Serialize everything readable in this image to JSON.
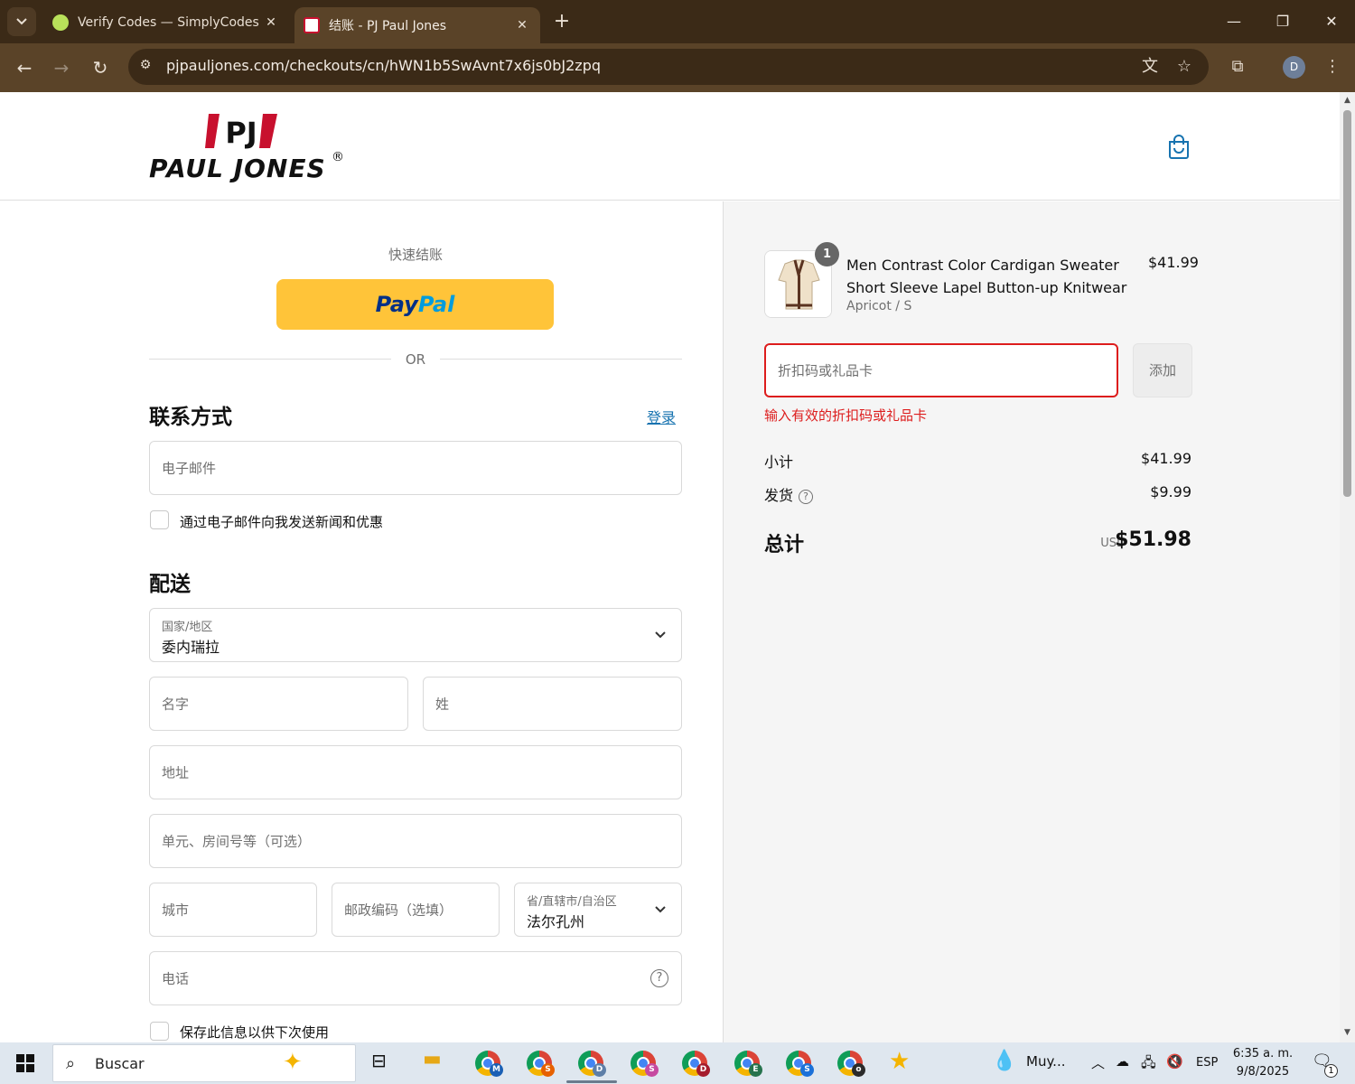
{
  "browser": {
    "tabs": [
      {
        "title": "Verify Codes — SimplyCodes",
        "active": false,
        "close_label": "✕"
      },
      {
        "title": "结账 - PJ Paul Jones",
        "active": true,
        "close_label": "✕"
      }
    ],
    "new_tab_label": "+",
    "url": "pjpauljones.com/checkouts/cn/hWN1b5SwAvnt7x6js0bJ2zpq",
    "profile_initial": "D",
    "accent_color": "#3b2a17"
  },
  "header": {
    "brand": "PAUL JONES",
    "brand_mark": "PJ",
    "registered": "®"
  },
  "express": {
    "title": "快速结账",
    "paypal_part1": "Pay",
    "paypal_part2": "Pal",
    "or_label": "OR"
  },
  "contact": {
    "title": "联系方式",
    "login_label": "登录",
    "email_placeholder": "电子邮件",
    "newsletter_label": "通过电子邮件向我发送新闻和优惠"
  },
  "shipping": {
    "title": "配送",
    "country_label": "国家/地区",
    "country_value": "委内瑞拉",
    "first_name_placeholder": "名字",
    "last_name_placeholder": "姓",
    "address_placeholder": "地址",
    "apartment_placeholder": "单元、房间号等（可选）",
    "city_placeholder": "城市",
    "postal_placeholder": "邮政编码（选填）",
    "state_label": "省/直辖市/自治区",
    "state_value": "法尔孔州",
    "phone_placeholder": "电话",
    "save_info_label": "保存此信息以供下次使用"
  },
  "summary": {
    "product": {
      "name": "Men Contrast Color Cardigan Sweater Short Sleeve Lapel Button-up Knitwear",
      "variant": "Apricot / S",
      "price": "$41.99",
      "quantity": "1"
    },
    "discount_placeholder": "折扣码或礼品卡",
    "add_button_label": "添加",
    "error_message": "输入有效的折扣码或礼品卡",
    "subtotal_label": "小计",
    "subtotal_value": "$41.99",
    "shipping_label": "发货",
    "shipping_value": "$9.99",
    "total_label": "总计",
    "total_currency": "USD",
    "total_value": "$51.98",
    "error_color": "#dd1d1d"
  },
  "taskbar": {
    "search_placeholder": "Buscar",
    "app_badges": [
      "M",
      "S",
      "D",
      "S",
      "D",
      "E",
      "S",
      "o"
    ],
    "weather": "Muy...",
    "language": "ESP",
    "time": "6:35 a. m.",
    "date": "9/8/2025",
    "notification_count": "1"
  }
}
